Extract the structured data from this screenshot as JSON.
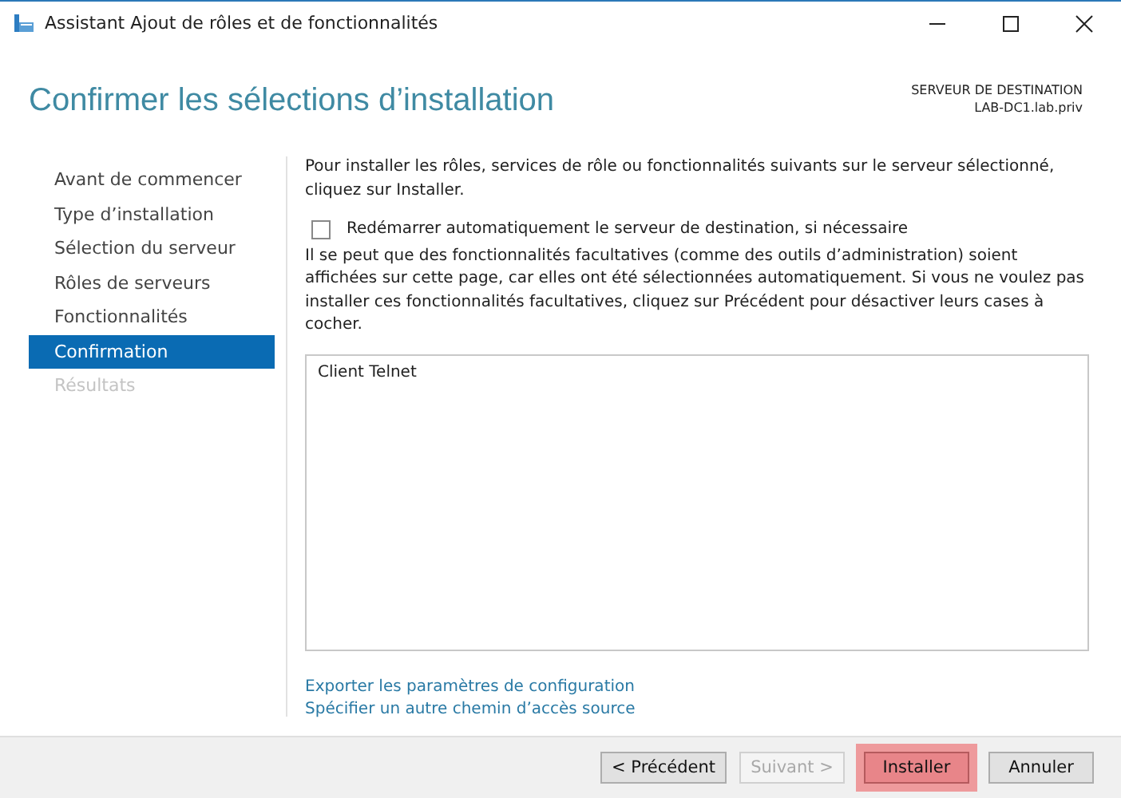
{
  "window": {
    "title": "Assistant Ajout de rôles et de fonctionnalités"
  },
  "header": {
    "title": "Confirmer les sélections d’installation",
    "destination_label": "SERVEUR DE DESTINATION",
    "destination_server": "LAB-DC1.lab.priv"
  },
  "sidebar": {
    "items": [
      {
        "label": "Avant de commencer",
        "selected": false,
        "disabled": false
      },
      {
        "label": "Type d’installation",
        "selected": false,
        "disabled": false
      },
      {
        "label": "Sélection du serveur",
        "selected": false,
        "disabled": false
      },
      {
        "label": "Rôles de serveurs",
        "selected": false,
        "disabled": false
      },
      {
        "label": "Fonctionnalités",
        "selected": false,
        "disabled": false
      },
      {
        "label": "Confirmation",
        "selected": true,
        "disabled": false
      },
      {
        "label": "Résultats",
        "selected": false,
        "disabled": true
      }
    ]
  },
  "content": {
    "intro": "Pour installer les rôles, services de rôle ou fonctionnalités suivants sur le serveur sélectionné, cliquez sur Installer.",
    "restart_option": {
      "label": "Redémarrer automatiquement le serveur de destination, si nécessaire",
      "checked": false
    },
    "note": "Il se peut que des fonctionnalités facultatives (comme des outils d’administration) soient affichées sur cette page, car elles ont été sélectionnées automatiquement. Si vous ne voulez pas installer ces fonctionnalités facultatives, cliquez sur Précédent pour désactiver leurs cases à cocher.",
    "selections": [
      "Client Telnet"
    ],
    "links": [
      "Exporter les paramètres de configuration",
      "Spécifier un autre chemin d’accès source"
    ]
  },
  "buttons": [
    {
      "label": "< Précédent",
      "disabled": false,
      "highlighted": false
    },
    {
      "label": "Suivant >",
      "disabled": true,
      "highlighted": false
    },
    {
      "label": "Installer",
      "disabled": false,
      "highlighted": true
    },
    {
      "label": "Annuler",
      "disabled": false,
      "highlighted": false
    }
  ]
}
